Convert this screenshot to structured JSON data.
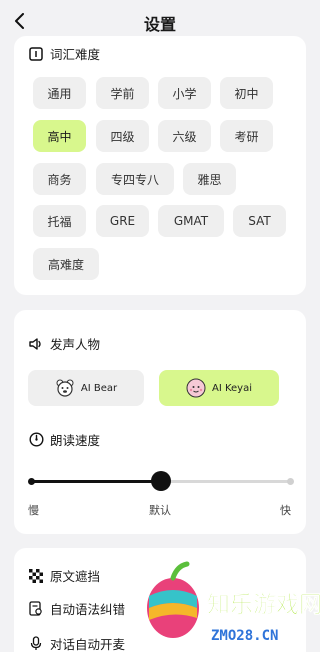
{
  "header": {
    "title": "设置"
  },
  "vocab": {
    "title": "词汇难度",
    "options": [
      "通用",
      "学前",
      "小学",
      "初中",
      "高中",
      "四级",
      "六级",
      "考研",
      "商务",
      "专四专八",
      "雅思",
      "托福",
      "GRE",
      "GMAT",
      "SAT",
      "高难度"
    ],
    "selected": "高中"
  },
  "voice": {
    "title": "发声人物",
    "options": [
      {
        "label": "AI Bear",
        "selected": false
      },
      {
        "label": "AI Keyai",
        "selected": true
      }
    ]
  },
  "speed": {
    "title": "朗读速度",
    "labels": [
      "慢",
      "默认",
      "快"
    ],
    "value_fraction": 0.5
  },
  "features": {
    "items": [
      "原文遮挡",
      "自动语法纠错",
      "对话自动开麦"
    ]
  },
  "watermark": {
    "text": "知乐游戏网",
    "domain": "ZMO28.CN"
  },
  "colors": {
    "accent": "#d8f78d",
    "background": "#f2f2f4",
    "chip": "#efefef"
  }
}
